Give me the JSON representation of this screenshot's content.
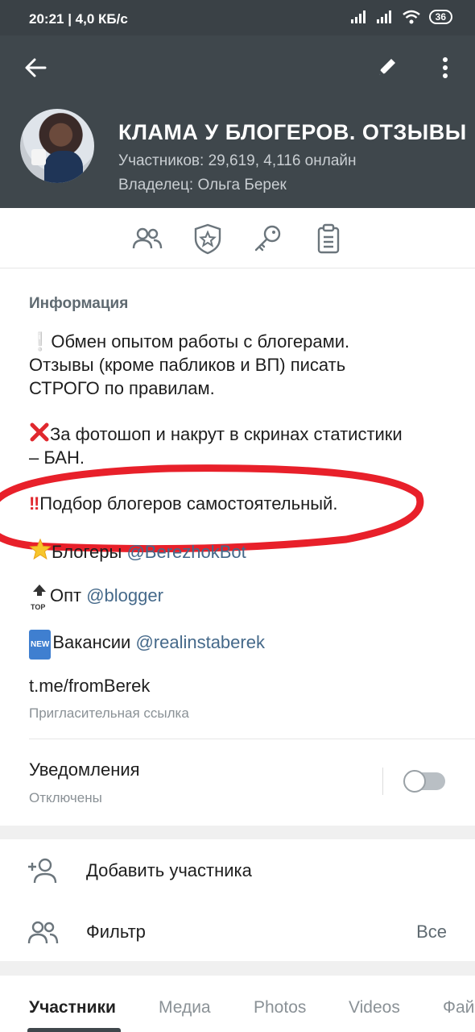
{
  "status_bar": {
    "time": "20:21 | 4,0 КБ/с",
    "battery": "36"
  },
  "header": {
    "title": "КЛАМА У БЛОГЕРОВ. ОТЗЫВЫ",
    "members": "Участников: 29,619, 4,116 онлайн",
    "owner": "Владелец:  Ольга Берек"
  },
  "info": {
    "heading": "Информация",
    "line1a": "❕Обмен опытом работы с блогерами.",
    "line1b": "Отзывы (кроме пабликов и ВП) писать",
    "line1c": "СТРОГО по правилам.",
    "line2a": "За фотошоп и накрут в скринах статистики",
    "line2b": "– БАН.",
    "line3": "Подбор блогеров самостоятельный.",
    "bloggers_label": "Блогеры ",
    "bloggers_link": "@BerezhokBot",
    "opt_label": "Опт ",
    "opt_link": "@blogger",
    "vac_label": "Вакансии ",
    "vac_link": "@realinstaberek",
    "top_badge": "TOP",
    "new_badge": "NEW"
  },
  "invite": {
    "link": "t.me/fromBerek",
    "label": "Пригласительная ссылка"
  },
  "notifications": {
    "label": "Уведомления",
    "status": "Отключены",
    "enabled": false
  },
  "actions": {
    "add_member": "Добавить участника",
    "filter": "Фильтр",
    "filter_value": "Все"
  },
  "tabs": [
    "Участники",
    "Медиа",
    "Photos",
    "Videos",
    "Фай"
  ],
  "colors": {
    "header_bg": "#3f474c",
    "link": "#45698a",
    "highlight_circle": "#e8202a"
  }
}
